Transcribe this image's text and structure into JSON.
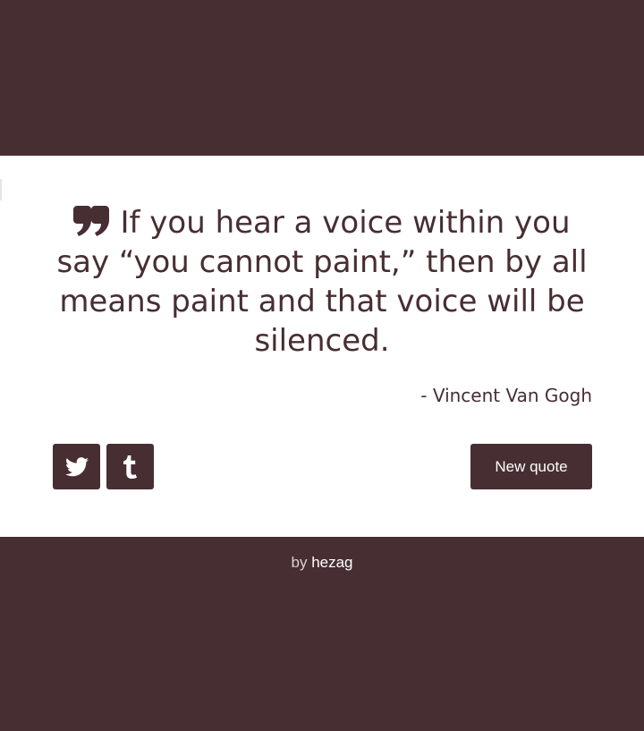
{
  "theme": {
    "background_color": "#472e32",
    "card_color": "#ffffff",
    "text_color": "#472e32",
    "button_color": "#472e32",
    "button_text_color": "#ffffff"
  },
  "quote": {
    "icon": "quote-left-icon",
    "text": "If you hear a voice within you say “you cannot paint,” then by all means paint and that voice will be silenced.",
    "author": "- Vincent Van Gogh"
  },
  "actions": {
    "twitter_icon": "twitter-icon",
    "tumblr_icon": "tumblr-icon",
    "new_quote_label": "New quote"
  },
  "footer": {
    "prefix": "by",
    "author_link": "hezag"
  }
}
